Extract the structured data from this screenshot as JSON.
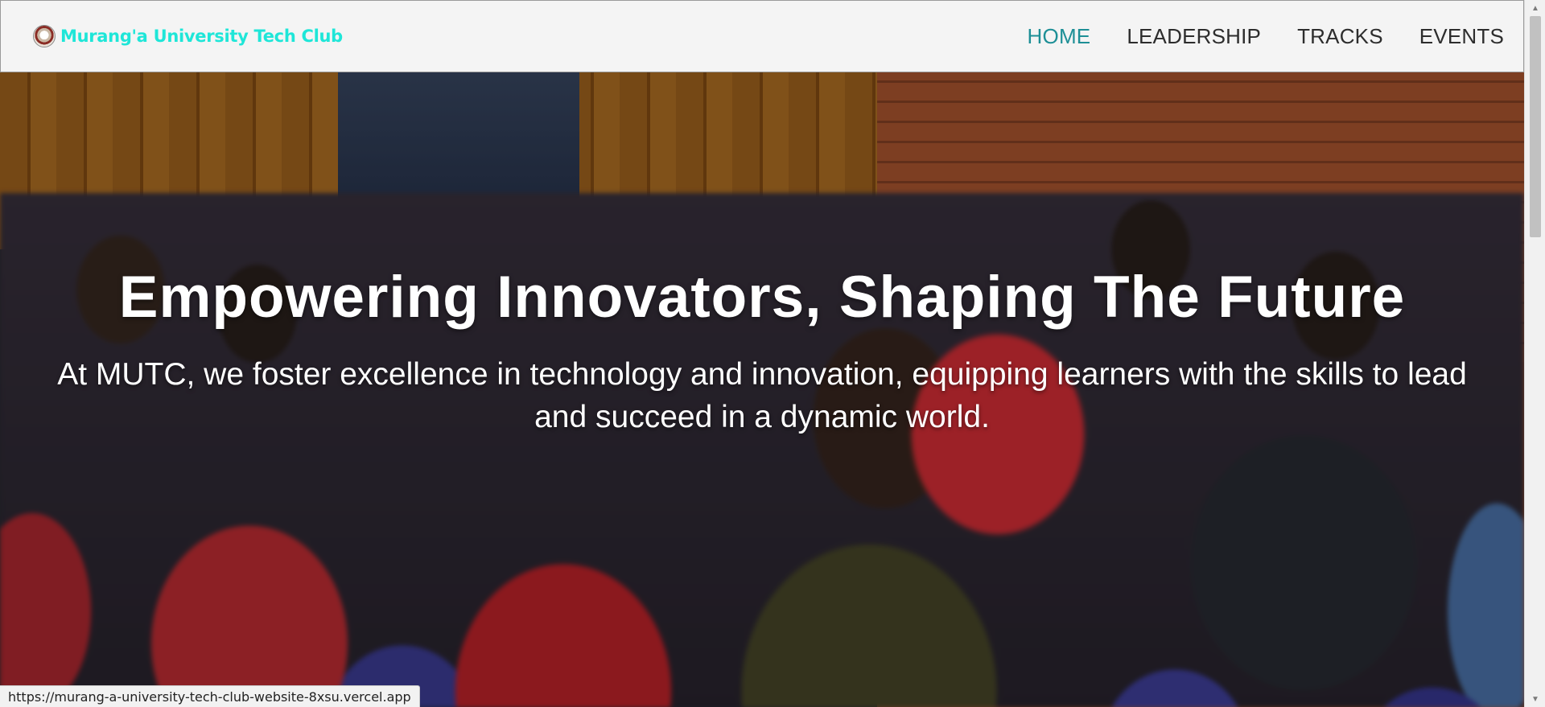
{
  "brand": {
    "logo_icon": "university-seal-icon",
    "name": "Murang'a University Tech Club",
    "color": "#1ee6d8"
  },
  "nav": {
    "items": [
      {
        "label": "HOME",
        "active": true
      },
      {
        "label": "LEADERSHIP",
        "active": false
      },
      {
        "label": "TRACKS",
        "active": false
      },
      {
        "label": "EVENTS",
        "active": false
      }
    ],
    "active_color": "#1d8f96"
  },
  "hero": {
    "title": "Empowering Innovators, Shaping The Future",
    "subtitle": "At MUTC, we foster excellence in technology and innovation, equipping learners with the skills to lead and succeed in a dynamic world.",
    "background": "photo of students seated in a lecture hall"
  },
  "status_bar": {
    "url": "https://murang-a-university-tech-club-website-8xsu.vercel.app"
  }
}
